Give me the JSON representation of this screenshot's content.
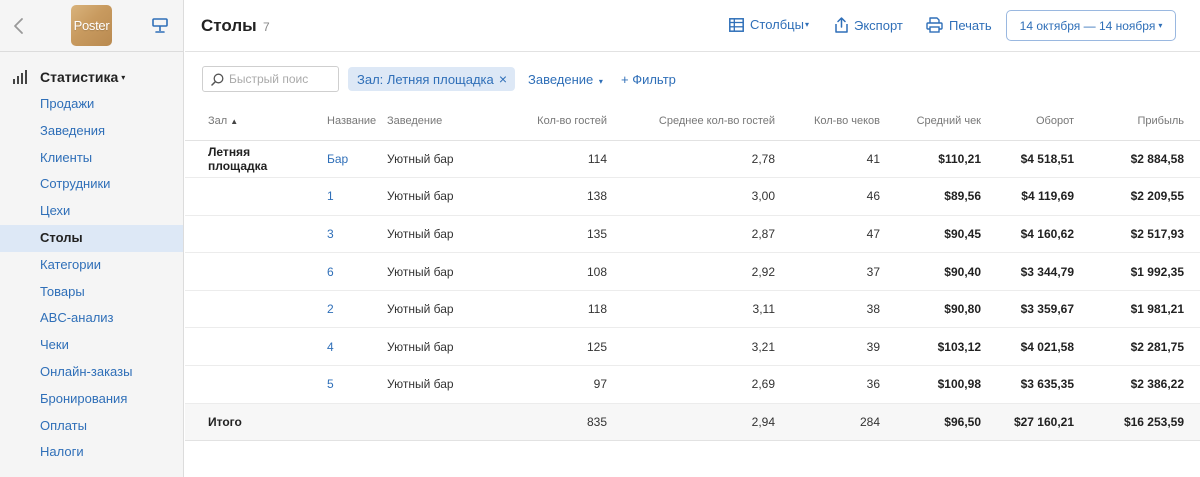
{
  "sidebar": {
    "logo_text": "Poster",
    "section_label": "Статистика",
    "items": [
      {
        "label": "Продажи",
        "active": false
      },
      {
        "label": "Заведения",
        "active": false
      },
      {
        "label": "Клиенты",
        "active": false
      },
      {
        "label": "Сотрудники",
        "active": false
      },
      {
        "label": "Цехи",
        "active": false
      },
      {
        "label": "Столы",
        "active": true
      },
      {
        "label": "Категории",
        "active": false
      },
      {
        "label": "Товары",
        "active": false
      },
      {
        "label": "ABC-анализ",
        "active": false
      },
      {
        "label": "Чеки",
        "active": false
      },
      {
        "label": "Онлайн-заказы",
        "active": false
      },
      {
        "label": "Бронирования",
        "active": false
      },
      {
        "label": "Оплаты",
        "active": false
      },
      {
        "label": "Налоги",
        "active": false
      }
    ]
  },
  "header": {
    "title": "Столы",
    "count": "7",
    "columns_label": "Столбцы",
    "export_label": "Экспорт",
    "print_label": "Печать",
    "date_range": "14 октября — 14 ноября"
  },
  "filters": {
    "search_placeholder": "Быстрый поис",
    "chip_label": "Зал: Летняя площадка",
    "chip_close": "×",
    "venue_dropdown": "Заведение",
    "add_filter": "+ Фильтр"
  },
  "table": {
    "headers": {
      "zal": "Зал",
      "name": "Название",
      "venue": "Заведение",
      "guests": "Кол-во гостей",
      "avg_guests": "Среднее кол-во гостей",
      "checks": "Кол-во чеков",
      "avg_check": "Средний чек",
      "turnover": "Оборот",
      "profit": "Прибыль"
    },
    "rows": [
      {
        "zal": "Летняя площадка",
        "name": "Бар",
        "venue": "Уютный бар",
        "guests": "114",
        "avg_guests": "2,78",
        "checks": "41",
        "avg_check": "$110,21",
        "turnover": "$4 518,51",
        "profit": "$2 884,58"
      },
      {
        "zal": "",
        "name": "1",
        "venue": "Уютный бар",
        "guests": "138",
        "avg_guests": "3,00",
        "checks": "46",
        "avg_check": "$89,56",
        "turnover": "$4 119,69",
        "profit": "$2 209,55"
      },
      {
        "zal": "",
        "name": "3",
        "venue": "Уютный бар",
        "guests": "135",
        "avg_guests": "2,87",
        "checks": "47",
        "avg_check": "$90,45",
        "turnover": "$4 160,62",
        "profit": "$2 517,93"
      },
      {
        "zal": "",
        "name": "6",
        "venue": "Уютный бар",
        "guests": "108",
        "avg_guests": "2,92",
        "checks": "37",
        "avg_check": "$90,40",
        "turnover": "$3 344,79",
        "profit": "$1 992,35"
      },
      {
        "zal": "",
        "name": "2",
        "venue": "Уютный бар",
        "guests": "118",
        "avg_guests": "3,11",
        "checks": "38",
        "avg_check": "$90,80",
        "turnover": "$3 359,67",
        "profit": "$1 981,21"
      },
      {
        "zal": "",
        "name": "4",
        "venue": "Уютный бар",
        "guests": "125",
        "avg_guests": "3,21",
        "checks": "39",
        "avg_check": "$103,12",
        "turnover": "$4 021,58",
        "profit": "$2 281,75"
      },
      {
        "zal": "",
        "name": "5",
        "venue": "Уютный бар",
        "guests": "97",
        "avg_guests": "2,69",
        "checks": "36",
        "avg_check": "$100,98",
        "turnover": "$3 635,35",
        "profit": "$2 386,22"
      }
    ],
    "total": {
      "label": "Итого",
      "guests": "835",
      "avg_guests": "2,94",
      "checks": "284",
      "avg_check": "$96,50",
      "turnover": "$27 160,21",
      "profit": "$16 253,59"
    }
  },
  "colors": {
    "accent": "#2f6fb8",
    "active_bg": "#dde8f6",
    "sidebar_bg": "#f5f5f5"
  }
}
